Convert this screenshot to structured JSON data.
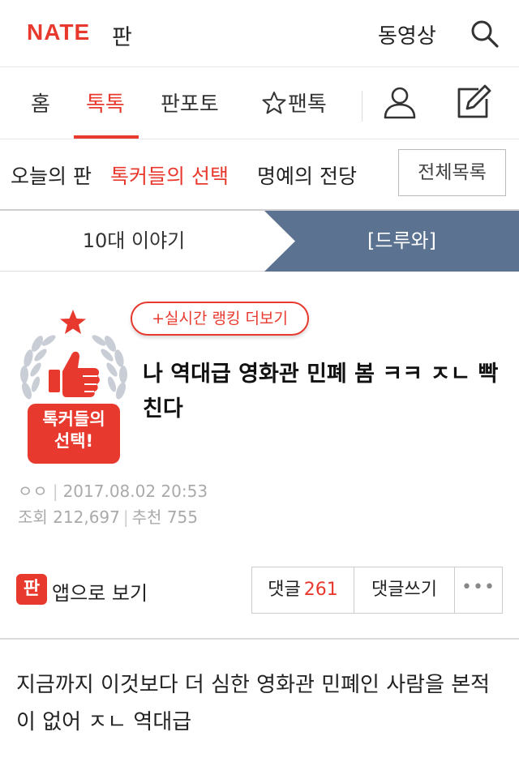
{
  "header": {
    "logo": "NATE",
    "service": "판",
    "video_link": "동영상"
  },
  "nav": {
    "tabs": [
      {
        "label": "홈"
      },
      {
        "label": "톡톡"
      },
      {
        "label": "판포토"
      },
      {
        "label": "팬톡"
      }
    ]
  },
  "subnav": {
    "items": [
      {
        "label": "오늘의 판"
      },
      {
        "label": "톡커들의 선택"
      },
      {
        "label": "명예의 전당"
      }
    ],
    "all_list_button": "전체목록"
  },
  "category": {
    "left": "10대 이야기",
    "right": "[드루와]"
  },
  "article": {
    "badge_line1": "톡커들의",
    "badge_line2": "선택!",
    "ranking_pill": "+실시간 랭킹 더보기",
    "title": "나 역대급 영화관 민폐 봄 ㅋㅋ ㅈㄴ 빡친다",
    "author": "ㅇㅇ",
    "date": "2017.08.02 20:53",
    "views_label": "조회",
    "views": "212,697",
    "recommend_label": "추천",
    "recommend": "755",
    "app_view": "앱으로 보기",
    "app_icon_text": "판",
    "comments_label": "댓글",
    "comments_count": "261",
    "write_comment": "댓글쓰기",
    "more": "•••",
    "body": "지금까지 이것보다 더 심한 영화관 민폐인 사람을 본적이 없어 ㅈㄴ 역대급"
  },
  "colors": {
    "brand": "#e8392e",
    "category_active_bg": "#5b7290"
  }
}
